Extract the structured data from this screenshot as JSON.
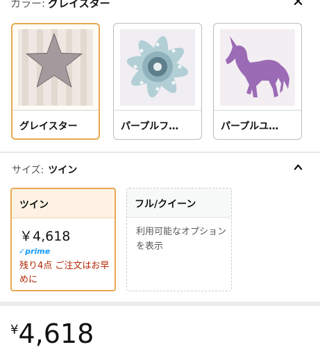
{
  "color_section": {
    "label": "カラー:",
    "selected": "グレイスター"
  },
  "swatches": [
    {
      "name": "グレイスター",
      "selected": true
    },
    {
      "name": "パープルフ…",
      "selected": false
    },
    {
      "name": "パープルユ…",
      "selected": false
    }
  ],
  "size_section": {
    "label": "サイズ:",
    "selected": "ツイン"
  },
  "sizes": [
    {
      "name": "ツイン",
      "price": "￥4,618",
      "prime": "prime",
      "stock": "残り4点 ご注文はお早めに"
    },
    {
      "name": "フル/クイーン",
      "message": "利用可能なオプションを表示"
    }
  ],
  "price": {
    "currency": "¥",
    "amount": "4,618"
  },
  "colors": {
    "accent_border": "#e5a850",
    "stock_text": "#b12704",
    "prime": "#1399ff"
  }
}
